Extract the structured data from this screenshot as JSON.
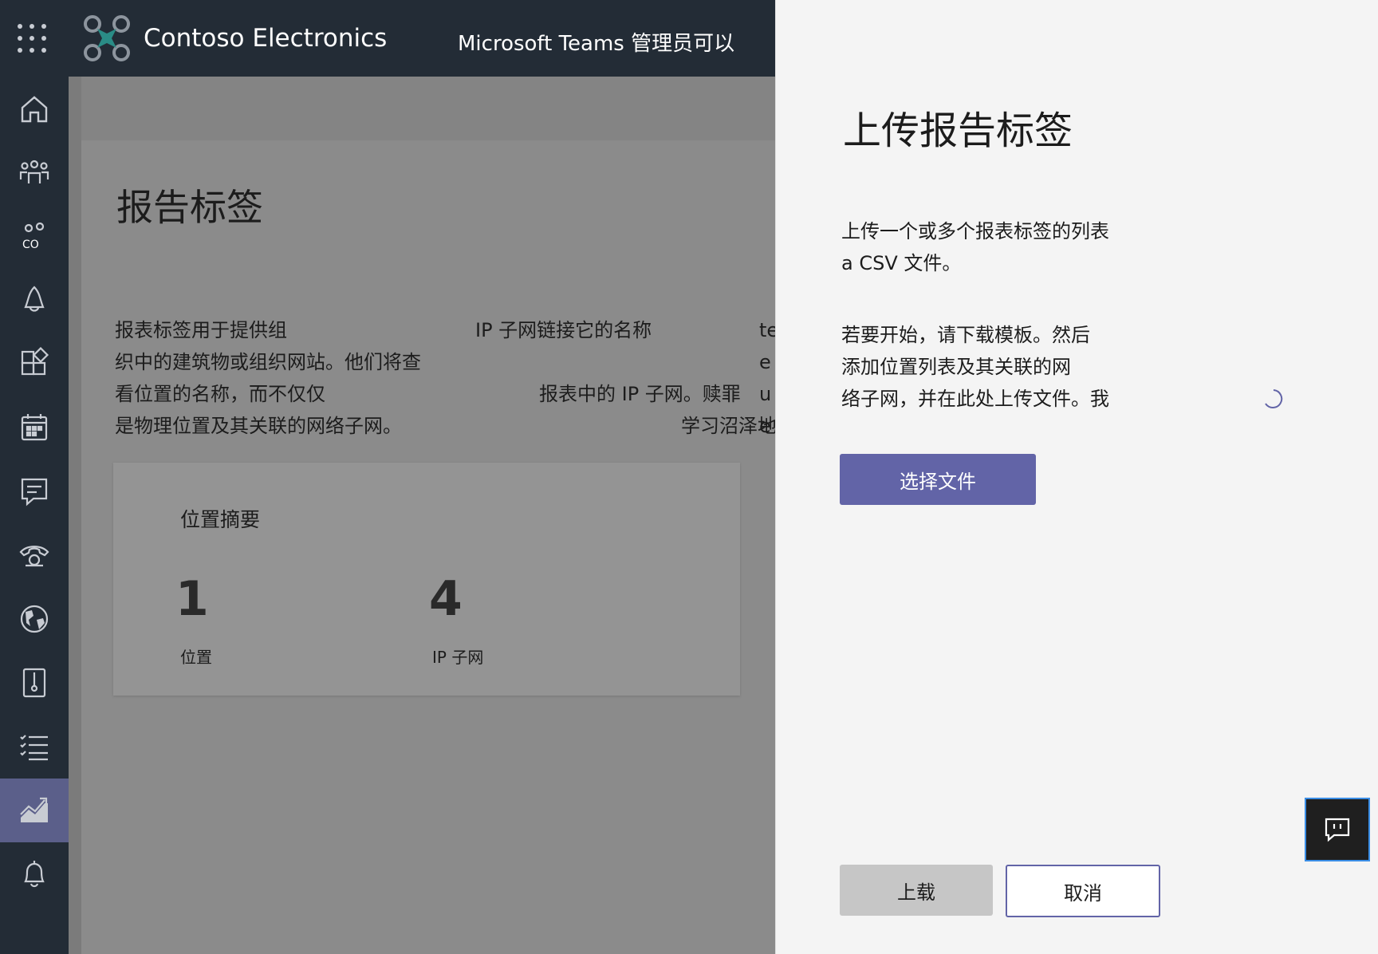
{
  "header": {
    "brand": "Contoso Electronics",
    "message": "Microsoft Teams 管理员可以"
  },
  "rail": {
    "items": [
      {
        "icon": "home-icon"
      },
      {
        "icon": "teams-icon"
      },
      {
        "icon": "users-icon",
        "label": "CO"
      },
      {
        "icon": "devices-icon"
      },
      {
        "icon": "apps-icon"
      },
      {
        "icon": "meetings-icon"
      },
      {
        "icon": "messaging-icon"
      },
      {
        "icon": "voice-icon"
      },
      {
        "icon": "locations-icon"
      },
      {
        "icon": "policy-packages-icon"
      },
      {
        "icon": "planning-icon"
      },
      {
        "icon": "analytics-icon"
      },
      {
        "icon": "notifications-icon"
      }
    ],
    "active": "analytics-icon"
  },
  "main": {
    "title": "报告标签",
    "description_left": [
      "报表标签用于提供组",
      "织中的建筑物或组织网站。他们将查",
      "看位置的名称，而不仅仅",
      "是物理位置及其关联的网络子网。"
    ],
    "description_mid": [
      "IP 子网链接它的名称",
      "",
      "报表中的 IP 子网。赎罪",
      "学习沼泽地"
    ],
    "description_right": [
      "te",
      "e",
      "u",
      "e"
    ],
    "summary": {
      "title": "位置摘要",
      "locations_value": "1",
      "locations_label": "位置",
      "subnets_value": "4",
      "subnets_label": "IP 子网"
    }
  },
  "panel": {
    "title": "上传报告标签",
    "para1": [
      "上传一个或多个报表标签的列表",
      "a CSV 文件。"
    ],
    "para2": [
      "若要开始，请下载模板。然后",
      "添加位置列表及其关联的网",
      "络子网，并在此处上传文件。我"
    ],
    "choose_file": "选择文件",
    "upload": "上载",
    "cancel": "取消"
  },
  "colors": {
    "header_bg": "#232c36",
    "accent": "#6264a7",
    "overlay_bg": "#8b8b8b",
    "panel_bg": "#f4f4f4"
  }
}
